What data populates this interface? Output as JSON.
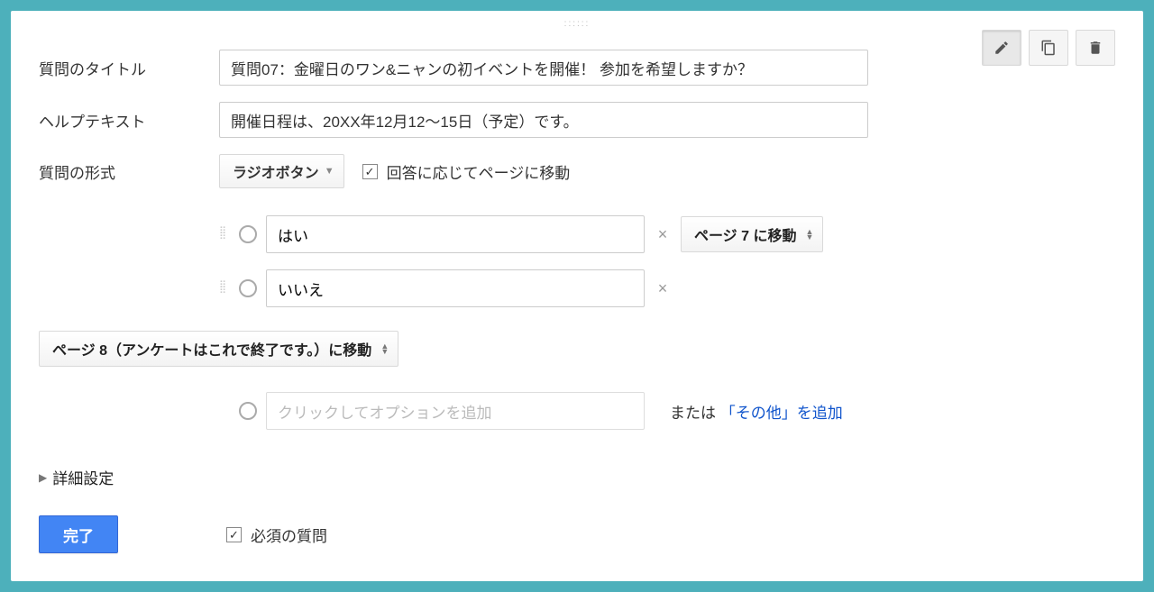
{
  "labels": {
    "title": "質問のタイトル",
    "help": "ヘルプテキスト",
    "type": "質問の形式",
    "branch": "回答に応じてページに移動",
    "addOption": "クリックしてオプションを追加",
    "orText": "または ",
    "addOther": "「その他」を追加",
    "advanced": "詳細設定",
    "done": "完了",
    "required": "必須の質問"
  },
  "values": {
    "title": "質問07：金曜日のワン&ニャンの初イベントを開催！ 参加を希望しますか？",
    "help": "開催日程は、20XX年12月12〜15日（予定）です。",
    "typeSelected": "ラジオボタン"
  },
  "options": [
    {
      "value": "はい",
      "goto": "ページ 7 に移動"
    },
    {
      "value": "いいえ",
      "goto": ""
    }
  ],
  "gotoWide": "ページ 8（アンケートはこれで終了です。）に移動"
}
